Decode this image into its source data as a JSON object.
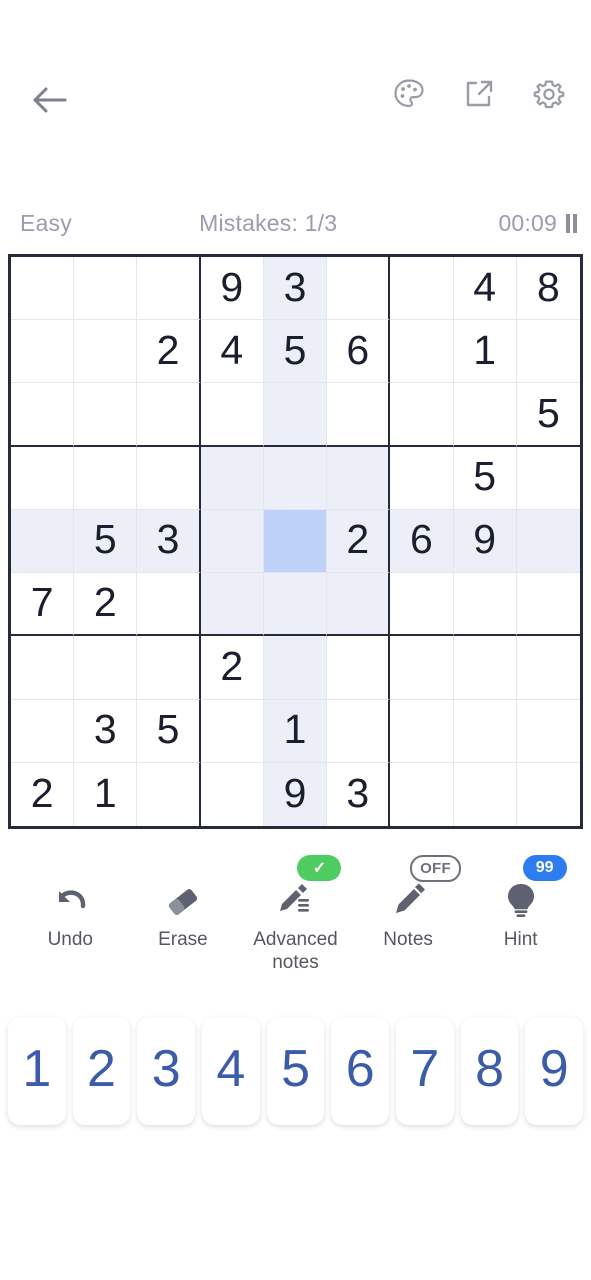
{
  "header": {
    "back_icon": "back-arrow-icon",
    "actions": [
      {
        "name": "theme-palette-icon",
        "label": "Theme"
      },
      {
        "name": "share-icon",
        "label": "Share"
      },
      {
        "name": "settings-gear-icon",
        "label": "Settings"
      }
    ]
  },
  "status": {
    "difficulty": "Easy",
    "mistakes": "Mistakes: 1/3",
    "timer": "00:09",
    "pause_icon": "pause-icon"
  },
  "board": {
    "selected": {
      "row": 4,
      "col": 4
    },
    "highlight_color": "#eceff7",
    "selected_color": "#bed2f7",
    "border_color": "#262a3d",
    "digit_color": "#1b1e2e",
    "rows": [
      [
        "",
        "",
        "",
        "9",
        "3",
        "",
        "",
        "4",
        "8"
      ],
      [
        "",
        "",
        "2",
        "4",
        "5",
        "6",
        "",
        "1",
        ""
      ],
      [
        "",
        "",
        "",
        "",
        "",
        "",
        "",
        "",
        "5"
      ],
      [
        "",
        "",
        "",
        "",
        "",
        "",
        "",
        "5",
        ""
      ],
      [
        "",
        "5",
        "3",
        "",
        "",
        "2",
        "6",
        "9",
        ""
      ],
      [
        "7",
        "2",
        "",
        "",
        "",
        "",
        "",
        "",
        ""
      ],
      [
        "",
        "",
        "",
        "2",
        "",
        "",
        "",
        "",
        ""
      ],
      [
        "",
        "3",
        "5",
        "",
        "1",
        "",
        "",
        "",
        ""
      ],
      [
        "2",
        "1",
        "",
        "",
        "9",
        "3",
        "",
        "",
        ""
      ]
    ]
  },
  "tools": [
    {
      "name": "undo-button",
      "icon": "undo-arrow-icon",
      "label": "Undo",
      "badge": null,
      "badge_type": null
    },
    {
      "name": "erase-button",
      "icon": "eraser-icon",
      "label": "Erase",
      "badge": null,
      "badge_type": null
    },
    {
      "name": "advanced-notes-button",
      "icon": "advanced-pencil-icon",
      "label": "Advanced\nnotes",
      "badge": "✓",
      "badge_type": "green"
    },
    {
      "name": "notes-button",
      "icon": "pencil-icon",
      "label": "Notes",
      "badge": "OFF",
      "badge_type": "off"
    },
    {
      "name": "hint-button",
      "icon": "lightbulb-icon",
      "label": "Hint",
      "badge": "99",
      "badge_type": "blue"
    }
  ],
  "numpad": {
    "keys": [
      "1",
      "2",
      "3",
      "4",
      "5",
      "6",
      "7",
      "8",
      "9"
    ],
    "color": "#3c5ba9"
  }
}
